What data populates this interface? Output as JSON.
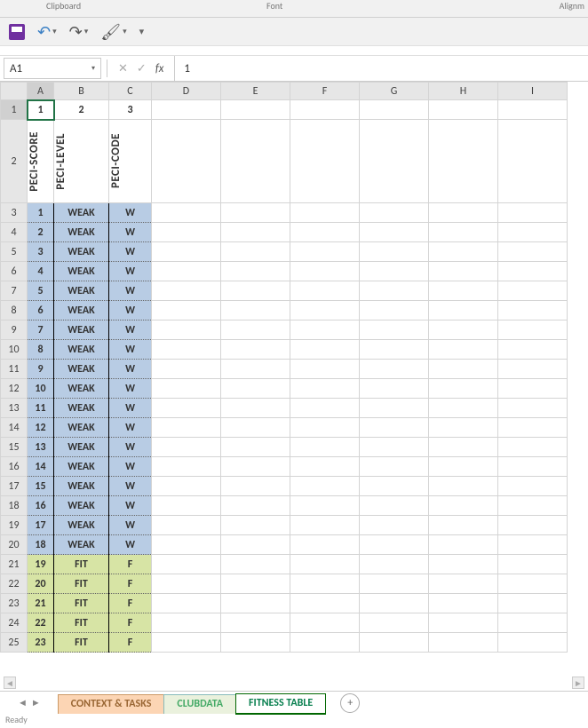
{
  "ribbon_labels": {
    "clipboard": "Clipboard",
    "font": "Font",
    "alignment": "Alignm"
  },
  "name_box": {
    "value": "A1"
  },
  "formula_bar": {
    "value": "1"
  },
  "columns": [
    "A",
    "B",
    "C",
    "D",
    "E",
    "F",
    "G",
    "H",
    "I"
  ],
  "active_cell": "A1",
  "row1": {
    "A": "1",
    "B": "2",
    "C": "3"
  },
  "row2_headers": {
    "A": "PECI-SCORE",
    "B": "PECI-LEVEL",
    "C": "PECI-CODE"
  },
  "data_rows": [
    {
      "r": 3,
      "A": "1",
      "B": "WEAK",
      "C": "W",
      "cls": "weak"
    },
    {
      "r": 4,
      "A": "2",
      "B": "WEAK",
      "C": "W",
      "cls": "weak"
    },
    {
      "r": 5,
      "A": "3",
      "B": "WEAK",
      "C": "W",
      "cls": "weak"
    },
    {
      "r": 6,
      "A": "4",
      "B": "WEAK",
      "C": "W",
      "cls": "weak"
    },
    {
      "r": 7,
      "A": "5",
      "B": "WEAK",
      "C": "W",
      "cls": "weak"
    },
    {
      "r": 8,
      "A": "6",
      "B": "WEAK",
      "C": "W",
      "cls": "weak"
    },
    {
      "r": 9,
      "A": "7",
      "B": "WEAK",
      "C": "W",
      "cls": "weak"
    },
    {
      "r": 10,
      "A": "8",
      "B": "WEAK",
      "C": "W",
      "cls": "weak"
    },
    {
      "r": 11,
      "A": "9",
      "B": "WEAK",
      "C": "W",
      "cls": "weak"
    },
    {
      "r": 12,
      "A": "10",
      "B": "WEAK",
      "C": "W",
      "cls": "weak"
    },
    {
      "r": 13,
      "A": "11",
      "B": "WEAK",
      "C": "W",
      "cls": "weak"
    },
    {
      "r": 14,
      "A": "12",
      "B": "WEAK",
      "C": "W",
      "cls": "weak"
    },
    {
      "r": 15,
      "A": "13",
      "B": "WEAK",
      "C": "W",
      "cls": "weak"
    },
    {
      "r": 16,
      "A": "14",
      "B": "WEAK",
      "C": "W",
      "cls": "weak"
    },
    {
      "r": 17,
      "A": "15",
      "B": "WEAK",
      "C": "W",
      "cls": "weak"
    },
    {
      "r": 18,
      "A": "16",
      "B": "WEAK",
      "C": "W",
      "cls": "weak"
    },
    {
      "r": 19,
      "A": "17",
      "B": "WEAK",
      "C": "W",
      "cls": "weak"
    },
    {
      "r": 20,
      "A": "18",
      "B": "WEAK",
      "C": "W",
      "cls": "weak"
    },
    {
      "r": 21,
      "A": "19",
      "B": "FIT",
      "C": "F",
      "cls": "fit"
    },
    {
      "r": 22,
      "A": "20",
      "B": "FIT",
      "C": "F",
      "cls": "fit"
    },
    {
      "r": 23,
      "A": "21",
      "B": "FIT",
      "C": "F",
      "cls": "fit"
    },
    {
      "r": 24,
      "A": "22",
      "B": "FIT",
      "C": "F",
      "cls": "fit"
    },
    {
      "r": 25,
      "A": "23",
      "B": "FIT",
      "C": "F",
      "cls": "fit"
    }
  ],
  "sheet_tabs": {
    "context": "CONTEXT & TASKS",
    "clubdata": "CLUBDATA",
    "fitness": "FITNESS TABLE"
  },
  "status_text": "Ready"
}
